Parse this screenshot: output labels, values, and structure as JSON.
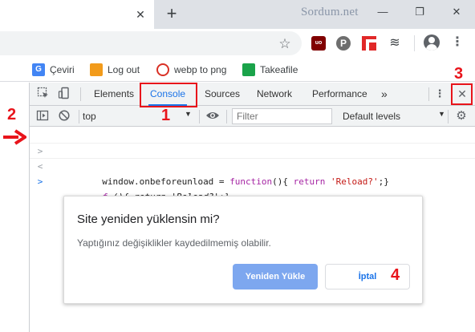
{
  "browser": {
    "watermark": "Sordum.net",
    "tab_close_glyph": "✕",
    "new_tab_glyph": "+",
    "window_controls": {
      "minimize": "—",
      "restore": "❐",
      "close": "✕"
    },
    "extensions": {
      "ublock": "uo",
      "pinterest": "P"
    }
  },
  "bookmarks": [
    {
      "label": "Çeviri",
      "icon": "translate-icon"
    },
    {
      "label": "Log out",
      "icon": "logout-icon"
    },
    {
      "label": "webp to png",
      "icon": "webp-icon"
    },
    {
      "label": "Takeafile",
      "icon": "takeafile-icon"
    }
  ],
  "devtools": {
    "tabs": [
      "Elements",
      "Console",
      "Sources",
      "Network",
      "Performance"
    ],
    "active_tab": "Console",
    "more_tabs": "»",
    "close": "✕",
    "context": "top",
    "filter_placeholder": "Filter",
    "levels": "Default levels",
    "console_lines": [
      {
        "prompt": ">",
        "kind": "input",
        "text": "window.onbeforeunload = function(){ return 'Reload?';}"
      },
      {
        "prompt": "<",
        "kind": "output",
        "text": "ƒ (){ return 'Reload?';}"
      },
      {
        "prompt": ">",
        "kind": "prompt",
        "text": ""
      }
    ]
  },
  "dialog": {
    "title": "Site yeniden yüklensin mi?",
    "message": "Yaptığınız değişiklikler kaydedilmemiş olabilir.",
    "primary_button": "Yeniden Yükle",
    "secondary_button": "İptal"
  },
  "annotations": [
    "1",
    "2",
    "3",
    "4"
  ],
  "colors": {
    "accent": "#1a73e8",
    "annotation": "#e8141b",
    "primary_button": "#7da7ef"
  }
}
